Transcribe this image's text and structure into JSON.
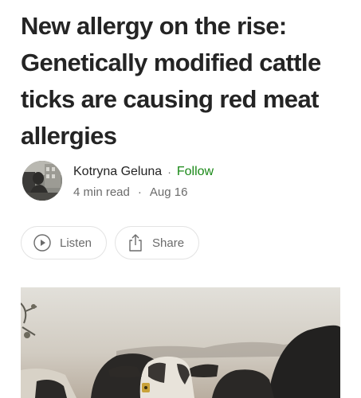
{
  "article": {
    "title": "New allergy on the rise: Genetically modified cattle ticks are causing red meat allergies"
  },
  "author": {
    "name": "Kotryna Geluna",
    "follow_label": "Follow",
    "separator": "·"
  },
  "meta": {
    "read_time": "4 min read",
    "date": "Aug 16",
    "separator": "·"
  },
  "actions": {
    "listen_label": "Listen",
    "share_label": "Share"
  },
  "icons": {
    "listen": "play-circle-icon",
    "share": "share-upload-icon"
  },
  "colors": {
    "text": "#242424",
    "muted": "#6b6b6b",
    "follow": "#1a8917",
    "border": "#e3e3e3"
  }
}
